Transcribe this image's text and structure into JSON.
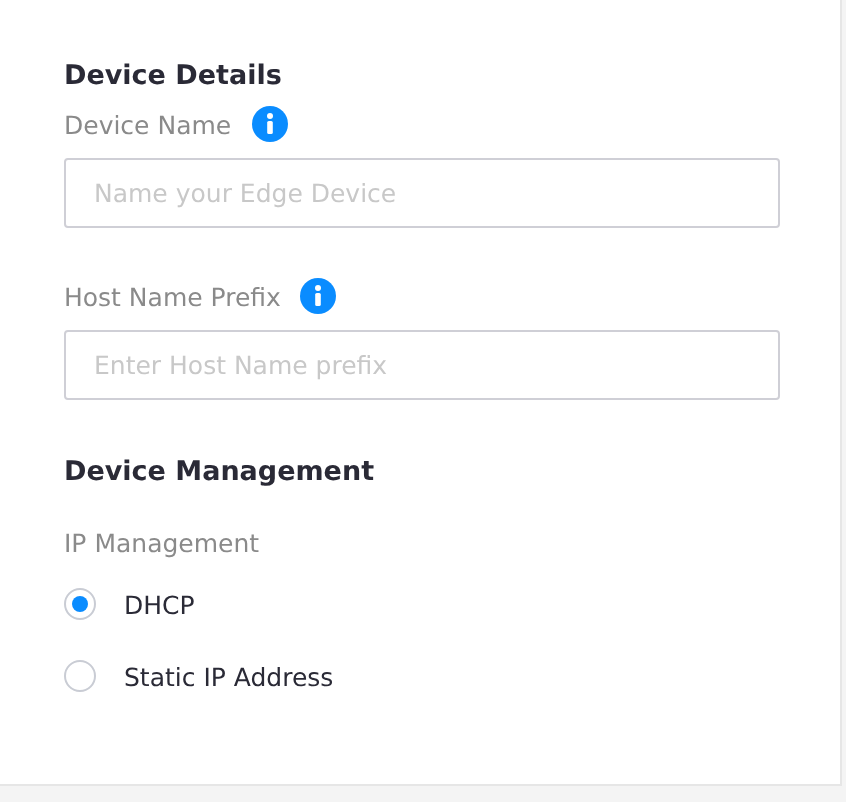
{
  "sections": [
    {
      "title": "Device Details",
      "kind": "fields",
      "fields": [
        {
          "label": "Device Name",
          "info": true,
          "placeholder": "Name your Edge Device"
        },
        {
          "label": "Host Name Prefix",
          "info": true,
          "placeholder": "Enter Host Name prefix"
        }
      ]
    },
    {
      "title": "Device Management",
      "kind": "radios",
      "group_label": "IP Management",
      "options": [
        {
          "label": "DHCP",
          "selected": true
        },
        {
          "label": "Static IP Address",
          "selected": false
        }
      ]
    }
  ]
}
